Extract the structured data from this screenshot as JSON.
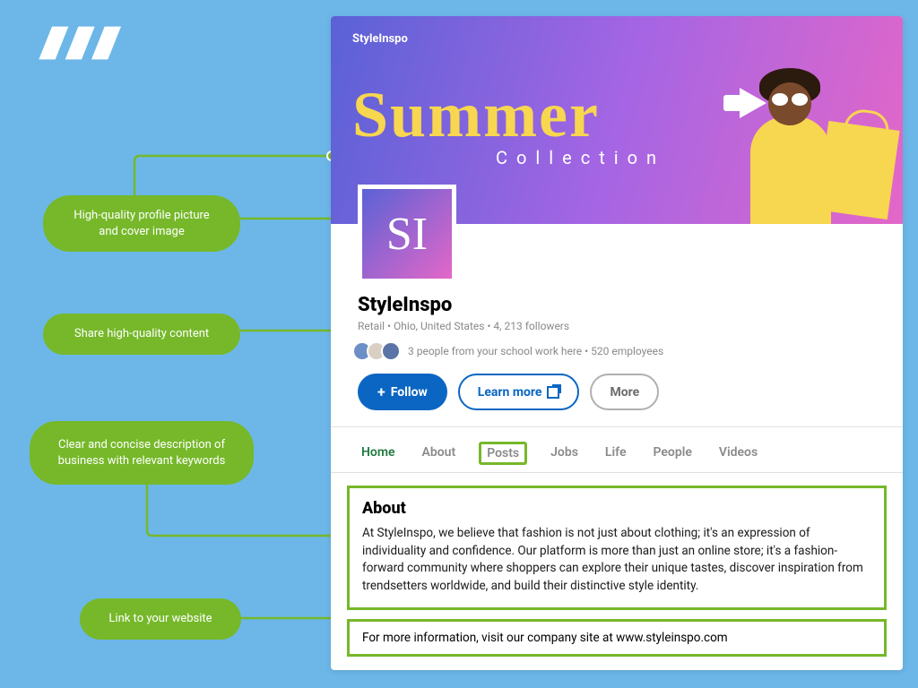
{
  "annotations": {
    "a1": "High-quality profile picture and cover image",
    "a2": "Share high-quality content",
    "a3": "Clear and concise description of business with relevant keywords",
    "a4": "Link to your website"
  },
  "cover": {
    "brand": "StyleInspo",
    "title": "Summer",
    "subtitle": "Collection"
  },
  "avatar": {
    "initials": "SI"
  },
  "page": {
    "name": "StyleInspo",
    "meta": "Retail • Ohio, United States • 4, 213 followers",
    "people_text": "3 people from your school work here • 520 employees"
  },
  "buttons": {
    "follow": "Follow",
    "learn_more": "Learn more",
    "more": "More"
  },
  "tabs": {
    "home": "Home",
    "about": "About",
    "posts": "Posts",
    "jobs": "Jobs",
    "life": "Life",
    "people": "People",
    "videos": "Videos"
  },
  "about": {
    "heading": "About",
    "body": "At StyleInspo, we believe that fashion is not just about clothing; it's an expression of individuality and confidence. Our platform is more than just an online store; it's a fashion-forward community where shoppers can explore their unique tastes, discover inspiration from trendsetters worldwide, and build their distinctive style identity.",
    "website": "For more information, visit our company site at www.styleinspo.com"
  }
}
